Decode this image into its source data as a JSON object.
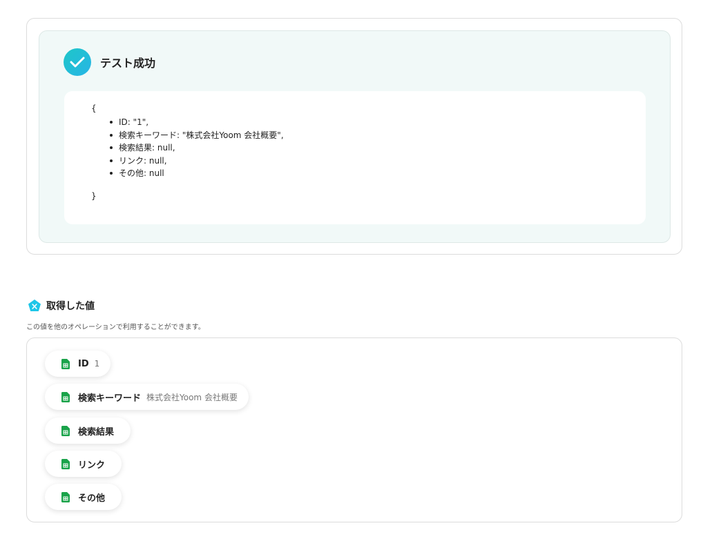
{
  "test_result": {
    "title": "テスト成功",
    "json_open": "{",
    "json_close": "}",
    "fields": [
      "ID: \"1\",",
      "検索キーワード: \"株式会社Yoom 会社概要\",",
      "検索結果: null,",
      "リンク: null,",
      "その他: null"
    ]
  },
  "values_section": {
    "title": "取得した値",
    "description": "この値を他のオペレーションで利用することができます。",
    "items": [
      {
        "label": "ID",
        "value": "1"
      },
      {
        "label": "検索キーワード",
        "value": "株式会社Yoom 会社概要"
      },
      {
        "label": "検索結果",
        "value": ""
      },
      {
        "label": "リンク",
        "value": ""
      },
      {
        "label": "その他",
        "value": ""
      }
    ]
  },
  "colors": {
    "accent": "#1ec6c8",
    "panel_bg": "#f1f9f8",
    "sheet_green": "#1aa34a"
  },
  "icons": {
    "success": "check-icon",
    "values": "pentagon-x-icon",
    "item": "spreadsheet-icon"
  }
}
